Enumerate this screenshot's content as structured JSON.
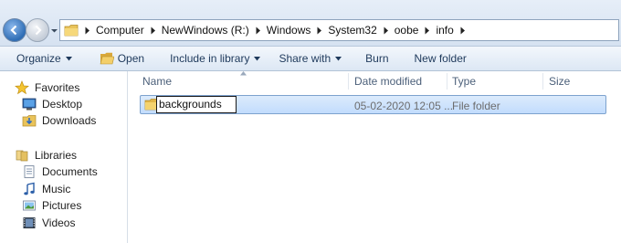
{
  "address_bar": {
    "crumbs": [
      "Computer",
      "NewWindows (R:)",
      "Windows",
      "System32",
      "oobe",
      "info"
    ]
  },
  "toolbar": {
    "organize_label": "Organize",
    "open_label": "Open",
    "include_label": "Include in library",
    "share_label": "Share with",
    "burn_label": "Burn",
    "new_folder_label": "New folder"
  },
  "nav_pane": {
    "favorites_label": "Favorites",
    "favorites": [
      {
        "label": "Desktop",
        "icon": "desktop-icon"
      },
      {
        "label": "Downloads",
        "icon": "downloads-icon"
      }
    ],
    "libraries_label": "Libraries",
    "libraries": [
      {
        "label": "Documents",
        "icon": "documents-icon"
      },
      {
        "label": "Music",
        "icon": "music-icon"
      },
      {
        "label": "Pictures",
        "icon": "pictures-icon"
      },
      {
        "label": "Videos",
        "icon": "videos-icon"
      }
    ]
  },
  "columns": {
    "name": "Name",
    "date_modified": "Date modified",
    "type": "Type",
    "size": "Size"
  },
  "files": [
    {
      "name": "backgrounds",
      "date_modified": "05-02-2020 12:05 ...",
      "type": "File folder",
      "size": "",
      "renaming": true
    }
  ],
  "colors": {
    "selection_fill": "#c2dcfd",
    "selection_border": "#7da2ce",
    "toolbar_text": "#1e395b"
  }
}
